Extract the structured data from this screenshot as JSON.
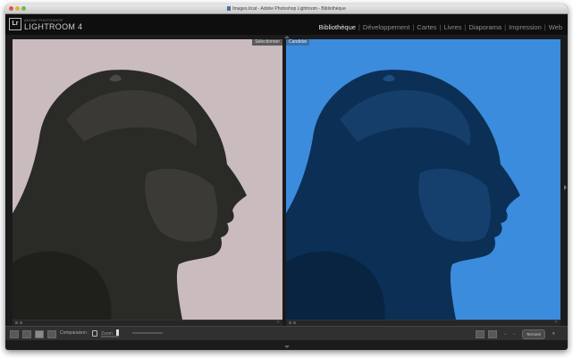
{
  "window": {
    "title": "Images.lrcat - Adobe Photoshop Lightroom - Bibliothèque"
  },
  "identity": {
    "logo_text": "Lr",
    "brand_small": "ADOBE PHOTOSHOP",
    "brand_main": "LIGHTROOM 4"
  },
  "modules": [
    {
      "label": "Bibliothèque",
      "active": true
    },
    {
      "label": "Développement",
      "active": false
    },
    {
      "label": "Cartes",
      "active": false
    },
    {
      "label": "Livres",
      "active": false
    },
    {
      "label": "Diaporama",
      "active": false
    },
    {
      "label": "Impression",
      "active": false
    },
    {
      "label": "Web",
      "active": false
    }
  ],
  "compare": {
    "select_label": "Sélectionner",
    "candidate_label": "Candidat",
    "left_tint": "#cabbbe",
    "right_tint": "#3c8cdd"
  },
  "toolbar": {
    "compare_label": "Comparaison :",
    "zoom_label": "Zoom",
    "done_label": "Terminé"
  },
  "icons": [
    "grid-view-icon",
    "loupe-view-icon",
    "compare-view-icon",
    "survey-view-icon",
    "lock-icon",
    "swap-icon",
    "make-select-icon",
    "prev-arrow-icon",
    "next-arrow-icon",
    "star-icon"
  ]
}
